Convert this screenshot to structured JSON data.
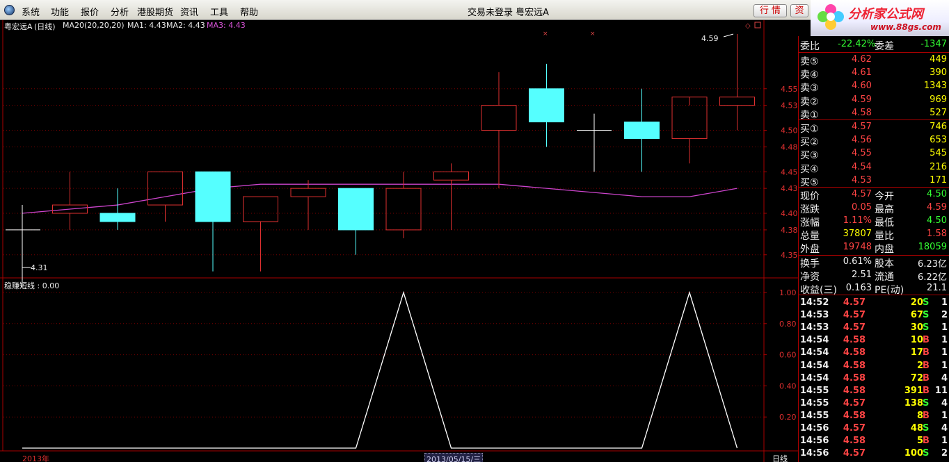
{
  "menu": {
    "items": [
      "系统",
      "功能",
      "报价",
      "分析",
      "港股期货",
      "资讯",
      "工具",
      "帮助"
    ],
    "window_title": "交易未登录   粤宏远A",
    "btn_quote": "行 情",
    "btn_info": "资"
  },
  "brand": {
    "name": "分析家公式网",
    "url": "www.88gs.com"
  },
  "kline": {
    "header": {
      "stock": "粤宏远A",
      "period": "(日线)",
      "ma20": "MA20(20,20,20)",
      "ma1": "MA1: 4.43",
      "ma2": "MA2: 4.43",
      "ma3": "MA3: 4.43"
    },
    "high_label": "4.59",
    "low_label": "4.31",
    "price_axis": [
      "4.55",
      "4.53",
      "4.50",
      "4.48",
      "4.45",
      "4.43",
      "4.40",
      "4.38",
      "4.35"
    ],
    "candles": [
      {
        "o": 4.4,
        "h": 4.45,
        "l": 4.38,
        "c": 4.41
      },
      {
        "o": 4.4,
        "h": 4.43,
        "l": 4.38,
        "c": 4.39
      },
      {
        "o": 4.41,
        "h": 4.45,
        "l": 4.39,
        "c": 4.45
      },
      {
        "o": 4.45,
        "h": 4.45,
        "l": 4.33,
        "c": 4.39
      },
      {
        "o": 4.39,
        "h": 4.42,
        "l": 4.33,
        "c": 4.42
      },
      {
        "o": 4.42,
        "h": 4.44,
        "l": 4.38,
        "c": 4.43
      },
      {
        "o": 4.43,
        "h": 4.43,
        "l": 4.35,
        "c": 4.38
      },
      {
        "o": 4.38,
        "h": 4.45,
        "l": 4.37,
        "c": 4.43
      },
      {
        "o": 4.44,
        "h": 4.46,
        "l": 4.38,
        "c": 4.45
      },
      {
        "o": 4.5,
        "h": 4.57,
        "l": 4.43,
        "c": 4.53
      },
      {
        "o": 4.55,
        "h": 4.58,
        "l": 4.48,
        "c": 4.51
      },
      {
        "o": 4.5,
        "h": 4.52,
        "l": 4.45,
        "c": 4.5
      },
      {
        "o": 4.51,
        "h": 4.55,
        "l": 4.45,
        "c": 4.49
      },
      {
        "o": 4.49,
        "h": 4.53,
        "l": 4.46,
        "c": 4.54
      },
      {
        "o": 4.53,
        "h": 4.59,
        "l": 4.5,
        "c": 4.54
      }
    ],
    "first_cross_price": 4.38,
    "ma_line": [
      4.4,
      4.405,
      4.41,
      4.42,
      4.43,
      4.435,
      4.435,
      4.435,
      4.435,
      4.435,
      4.435,
      4.43,
      4.425,
      4.42,
      4.42,
      4.43
    ]
  },
  "indicator": {
    "header": "稳赚短线 : 0.00",
    "axis": [
      "1.00",
      "0.80",
      "0.60",
      "0.40",
      "0.20"
    ],
    "values": [
      0,
      0,
      0,
      0,
      0,
      0,
      0,
      0,
      1,
      0,
      0,
      0,
      0,
      0,
      1,
      0
    ]
  },
  "footer": {
    "year": "2013年",
    "date": "2013/05/15/三",
    "period": "日线"
  },
  "quote": {
    "weibi_label": "委比",
    "weibi_value": "-22.42%",
    "weicha_label": "委差",
    "weicha_value": "-1347",
    "asks": [
      {
        "label": "卖⑤",
        "price": "4.62",
        "vol": "449"
      },
      {
        "label": "卖④",
        "price": "4.61",
        "vol": "390"
      },
      {
        "label": "卖③",
        "price": "4.60",
        "vol": "1343"
      },
      {
        "label": "卖②",
        "price": "4.59",
        "vol": "969"
      },
      {
        "label": "卖①",
        "price": "4.58",
        "vol": "527"
      }
    ],
    "bids": [
      {
        "label": "买①",
        "price": "4.57",
        "vol": "746"
      },
      {
        "label": "买②",
        "price": "4.56",
        "vol": "653"
      },
      {
        "label": "买③",
        "price": "4.55",
        "vol": "545"
      },
      {
        "label": "买④",
        "price": "4.54",
        "vol": "216"
      },
      {
        "label": "买⑤",
        "price": "4.53",
        "vol": "171"
      }
    ],
    "stats": [
      {
        "l1": "现价",
        "v1": "4.57",
        "l2": "今开",
        "v2": "4.50"
      },
      {
        "l1": "涨跌",
        "v1": "0.05",
        "l2": "最高",
        "v2": "4.59"
      },
      {
        "l1": "涨幅",
        "v1": "1.11%",
        "l2": "最低",
        "v2": "4.50"
      },
      {
        "l1": "总量",
        "v1": "37807",
        "l2": "量比",
        "v2": "1.58"
      },
      {
        "l1": "外盘",
        "v1": "19748",
        "l2": "内盘",
        "v2": "18059"
      }
    ],
    "fund": [
      {
        "l1": "换手",
        "v1": "0.61%",
        "l2": "股本",
        "v2": "6.23亿"
      },
      {
        "l1": "净资",
        "v1": "2.51",
        "l2": "流通",
        "v2": "6.22亿"
      },
      {
        "l1": "收益(三)",
        "v1": "0.163",
        "l2": "PE(动)",
        "v2": "21.1"
      }
    ],
    "ticks": [
      {
        "t": "14:52",
        "p": "4.57",
        "v": "20",
        "s": "S",
        "n": "1"
      },
      {
        "t": "14:53",
        "p": "4.57",
        "v": "67",
        "s": "S",
        "n": "2"
      },
      {
        "t": "14:53",
        "p": "4.57",
        "v": "30",
        "s": "S",
        "n": "1"
      },
      {
        "t": "14:54",
        "p": "4.58",
        "v": "10",
        "s": "B",
        "n": "1"
      },
      {
        "t": "14:54",
        "p": "4.58",
        "v": "17",
        "s": "B",
        "n": "1"
      },
      {
        "t": "14:54",
        "p": "4.58",
        "v": "2",
        "s": "B",
        "n": "1"
      },
      {
        "t": "14:54",
        "p": "4.58",
        "v": "72",
        "s": "B",
        "n": "4"
      },
      {
        "t": "14:55",
        "p": "4.58",
        "v": "391",
        "s": "B",
        "n": "11"
      },
      {
        "t": "14:55",
        "p": "4.57",
        "v": "138",
        "s": "S",
        "n": "4"
      },
      {
        "t": "14:55",
        "p": "4.58",
        "v": "8",
        "s": "B",
        "n": "1"
      },
      {
        "t": "14:56",
        "p": "4.57",
        "v": "48",
        "s": "S",
        "n": "4"
      },
      {
        "t": "14:56",
        "p": "4.58",
        "v": "5",
        "s": "B",
        "n": "1"
      },
      {
        "t": "14:56",
        "p": "4.57",
        "v": "100",
        "s": "S",
        "n": "2"
      }
    ]
  },
  "colors": {
    "up": "#e03030",
    "down": "#55ffff",
    "ma": "#cc44cc",
    "grid": "#7a0000",
    "indicator": "#ffffff"
  }
}
